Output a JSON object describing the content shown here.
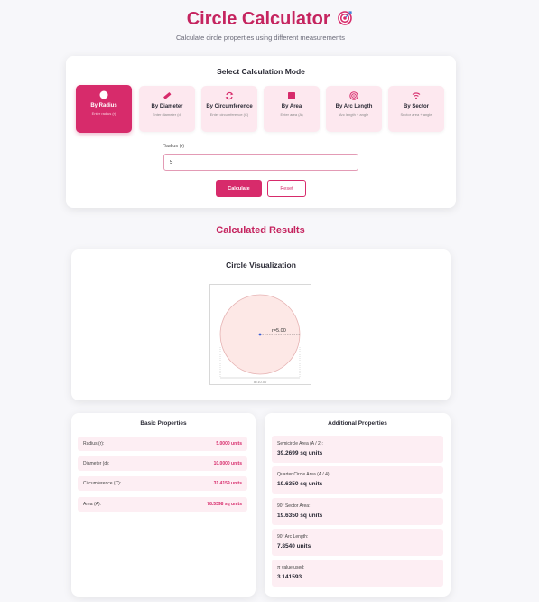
{
  "header": {
    "title": "Circle Calculator",
    "title_icon": "target-icon",
    "subtitle": "Calculate circle properties using different measurements"
  },
  "mode_section": {
    "title": "Select Calculation Mode",
    "modes": [
      {
        "label": "By Radius",
        "desc": "Enter radius (r)",
        "icon": "circle-icon",
        "active": true
      },
      {
        "label": "By Diameter",
        "desc": "Enter diameter (d)",
        "icon": "ruler-icon",
        "active": false
      },
      {
        "label": "By Circumference",
        "desc": "Enter circumference (C)",
        "icon": "refresh-icon",
        "active": false
      },
      {
        "label": "By Area",
        "desc": "Enter area (A)",
        "icon": "square-icon",
        "active": false
      },
      {
        "label": "By Arc Length",
        "desc": "Arc length + angle",
        "icon": "target-icon",
        "active": false
      },
      {
        "label": "By Sector",
        "desc": "Sector area + angle",
        "icon": "wifi-icon",
        "active": false
      }
    ],
    "input_label": "Radius (r)",
    "input_value": "5",
    "calculate_label": "Calculate",
    "reset_label": "Reset"
  },
  "results": {
    "title": "Calculated Results",
    "visualization": {
      "title": "Circle Visualization",
      "radius_label": "r=5.00",
      "diameter_label": "d=10.00"
    },
    "basic": {
      "title": "Basic Properties",
      "rows": [
        {
          "label": "Radius (r):",
          "value": "5.0000 units"
        },
        {
          "label": "Diameter (d):",
          "value": "10.0000 units"
        },
        {
          "label": "Circumference (C):",
          "value": "31.4159 units"
        },
        {
          "label": "Area (A):",
          "value": "78.5398 sq units"
        }
      ]
    },
    "additional": {
      "title": "Additional Properties",
      "rows": [
        {
          "label": "Semicircle Area (A / 2):",
          "value": "39.2699 sq units"
        },
        {
          "label": "Quarter Circle Area (A / 4):",
          "value": "19.6350 sq units"
        },
        {
          "label": "90° Sector Area:",
          "value": "19.6350 sq units"
        },
        {
          "label": "90° Arc Length:",
          "value": "7.8540 units"
        },
        {
          "label": "π value used:",
          "value": "3.141593"
        }
      ]
    }
  },
  "colors": {
    "accent": "#d72b6b",
    "title": "#c5245f",
    "tile_bg": "#fde8ef",
    "circle_fill": "#fde8e6"
  }
}
